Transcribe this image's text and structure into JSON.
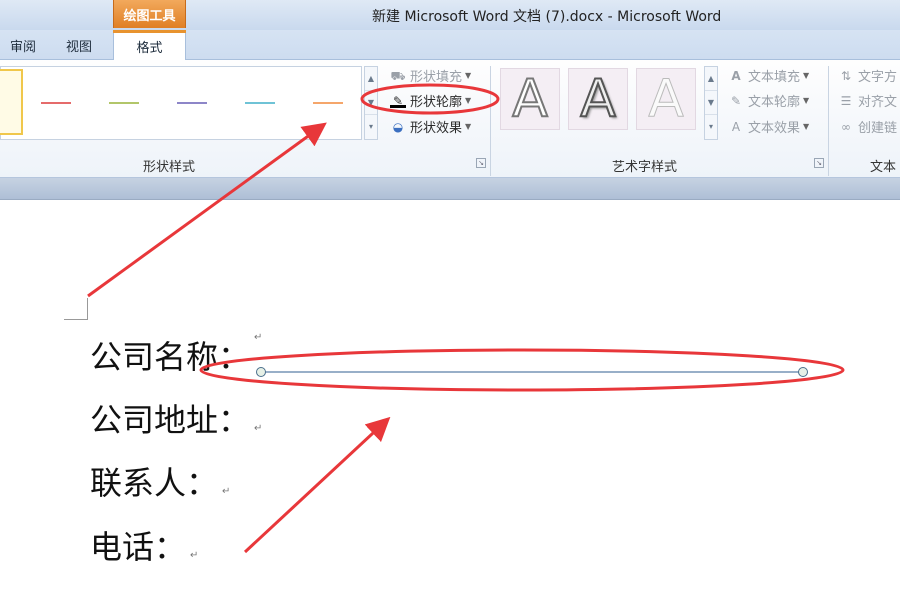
{
  "window": {
    "title": "新建 Microsoft Word 文档 (7).docx  -  Microsoft Word",
    "contextual_tab_header": "绘图工具"
  },
  "tabs": [
    "审阅",
    "视图",
    "格式"
  ],
  "active_tab": "格式",
  "ribbon": {
    "shape_styles": {
      "label": "形状样式",
      "line_colors": [
        "#e56b6b",
        "#b2c66a",
        "#8d86c8",
        "#6fc3d6",
        "#f5a66b"
      ],
      "commands": {
        "fill": "形状填充",
        "outline": "形状轮廓",
        "effects": "形状效果"
      }
    },
    "wordart_styles": {
      "label": "艺术字样式",
      "sample": "A",
      "commands": {
        "text_fill": "文本填充",
        "text_outline": "文本轮廓",
        "text_effects": "文本效果"
      }
    },
    "text_group": {
      "label": "文本",
      "commands": {
        "text_direction": "文字方",
        "align_text": "对齐文",
        "create_link": "创建链"
      }
    }
  },
  "document": {
    "lines": [
      "公司名称：",
      "公司地址：",
      "联系人：",
      "电话："
    ],
    "paragraph_mark": "↵"
  },
  "annotation_color": "#e8373a",
  "selected_line_color": "#5b7fa6"
}
